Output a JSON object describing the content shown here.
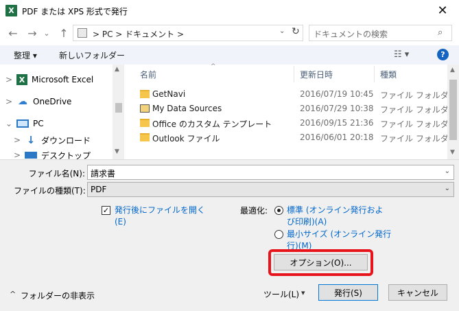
{
  "window": {
    "title": "PDF または XPS 形式で発行",
    "app_icon_letter": "X",
    "close_glyph": "✕"
  },
  "nav": {
    "back_glyph": "←",
    "forward_glyph": "→",
    "recent_glyph": "⌄",
    "up_glyph": "↑",
    "address_crumbs": ">  PC  >  ドキュメント  >",
    "refresh_glyph": "↻",
    "search_placeholder": "ドキュメントの検索"
  },
  "toolbar": {
    "organize_label": "整理 ▾",
    "new_folder_label": "新しいフォルダー",
    "view_glyph": "☷ ▾",
    "help_glyph": "?"
  },
  "navpane": {
    "items": [
      {
        "chevron": ">",
        "icon": "excel-icon",
        "icon_glyph": "X",
        "label": "Microsoft Excel"
      },
      {
        "chevron": ">",
        "icon": "cloud-icon",
        "icon_glyph": "☁",
        "label": "OneDrive"
      },
      {
        "chevron": "⌄",
        "icon": "pc-icon",
        "icon_glyph": "🖥",
        "label": "PC"
      },
      {
        "chevron": ">",
        "icon": "download-icon",
        "icon_glyph": "↓",
        "label": "ダウンロード"
      },
      {
        "chevron": ">",
        "icon": "desktop-icon",
        "icon_glyph": "▬",
        "label": "デスクトップ"
      }
    ]
  },
  "filelist": {
    "columns": {
      "name": "名前",
      "date": "更新日時",
      "type": "種類"
    },
    "sort_caret": "^",
    "rows": [
      {
        "name": "GetNavi",
        "date": "2016/07/19 10:45",
        "type": "ファイル フォルダー"
      },
      {
        "name": "My Data Sources",
        "date": "2016/07/29 10:38",
        "type": "ファイル フォルダー"
      },
      {
        "name": "Office のカスタム テンプレート",
        "date": "2016/09/15 21:36",
        "type": "ファイル フォルダー"
      },
      {
        "name": "Outlook ファイル",
        "date": "2016/06/01 20:18",
        "type": "ファイル フォルダー"
      }
    ]
  },
  "form": {
    "filename_label": "ファイル名(N):",
    "filename_value": "請求書",
    "filetype_label": "ファイルの種類(T):",
    "filetype_value": "PDF",
    "open_after_publish_line1": "発行後にファイルを開く",
    "open_after_publish_line2": "(E)",
    "open_after_publish_checked": true,
    "optimize_label": "最適化:",
    "standard_line1": "標準 (オンライン発行およ",
    "standard_line2": "び印刷)(A)",
    "minimum_line1": "最小サイズ (オンライン発行",
    "minimum_line2": "行)(M)",
    "options_button": "オプション(O)...",
    "hide_folders": "フォルダーの非表示",
    "hide_folders_caret": "^",
    "tools_label": "ツール(L)",
    "tools_caret": "▾",
    "publish_button": "発行(S)",
    "cancel_button": "キャンセル"
  },
  "colors": {
    "accent_blue": "#0078d7",
    "highlight_red": "#e8141b",
    "excel_green": "#1e7145",
    "folder_yellow": "#f5c64b"
  }
}
